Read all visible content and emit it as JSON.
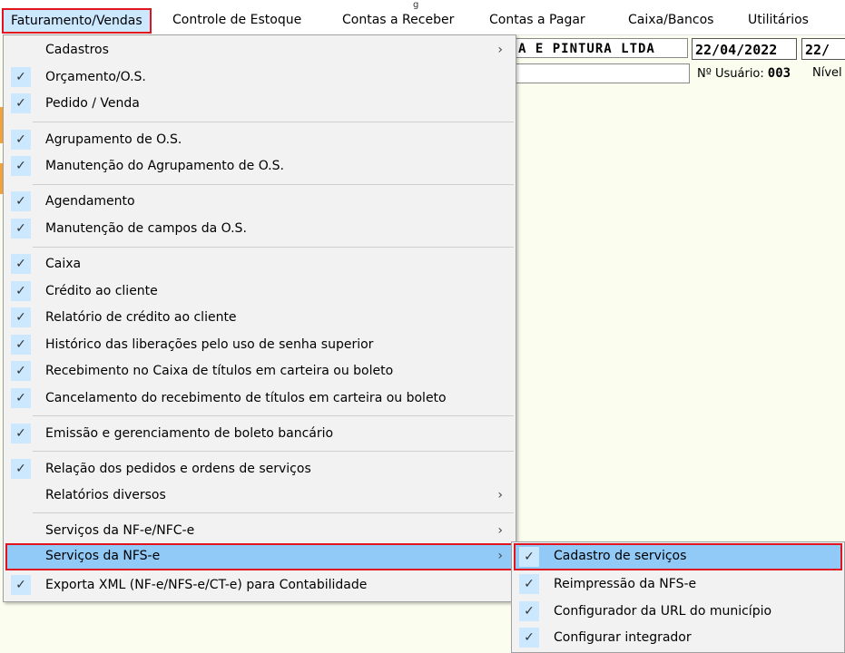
{
  "menubar": {
    "items": [
      {
        "label": "Faturamento/Vendas"
      },
      {
        "label": "Controle de Estoque"
      },
      {
        "label": "Contas a Receber"
      },
      {
        "label": "Contas a Pagar"
      },
      {
        "label": "Caixa/Bancos"
      },
      {
        "label": "Utilitários"
      }
    ]
  },
  "header": {
    "company": "A E PINTURA LTDA",
    "date1": "22/04/2022",
    "date2": "22/",
    "user_label": "Nº Usuário:",
    "user_number": "003",
    "nivel_label": "Nível"
  },
  "dropdown": {
    "items": [
      {
        "label": "Cadastros",
        "checked": false,
        "submenu": true
      },
      {
        "label": "Orçamento/O.S.",
        "checked": true
      },
      {
        "label": "Pedido / Venda",
        "checked": true
      },
      {
        "label": "Agrupamento de O.S.",
        "checked": true
      },
      {
        "label": "Manutenção do Agrupamento de O.S.",
        "checked": true
      },
      {
        "label": "Agendamento",
        "checked": true
      },
      {
        "label": "Manutenção de campos da O.S.",
        "checked": true
      },
      {
        "label": "Caixa",
        "checked": true
      },
      {
        "label": "Crédito ao cliente",
        "checked": true
      },
      {
        "label": "Relatório de crédito ao cliente",
        "checked": true
      },
      {
        "label": "Histórico das liberações pelo uso de senha superior",
        "checked": true
      },
      {
        "label": "Recebimento no Caixa de títulos em carteira ou boleto",
        "checked": true
      },
      {
        "label": "Cancelamento do recebimento de títulos em carteira ou boleto",
        "checked": true
      },
      {
        "label": "Emissão e gerenciamento de boleto bancário",
        "checked": true
      },
      {
        "label": "Relação dos pedidos e ordens de serviços",
        "checked": true
      },
      {
        "label": "Relatórios diversos",
        "checked": false,
        "submenu": true
      },
      {
        "label": "Serviços da NF-e/NFC-e",
        "checked": false,
        "submenu": true
      },
      {
        "label": "Serviços da NFS-e",
        "checked": false,
        "submenu": true,
        "highlighted": true
      },
      {
        "label": "Exporta XML (NF-e/NFS-e/CT-e) para Contabilidade",
        "checked": true
      }
    ]
  },
  "submenu": {
    "items": [
      {
        "label": "Cadastro de serviços",
        "checked": true,
        "highlighted": true
      },
      {
        "label": "Reimpressão da NFS-e",
        "checked": true
      },
      {
        "label": "Configurador da URL do município",
        "checked": true
      },
      {
        "label": "Configurar integrador",
        "checked": true
      }
    ]
  },
  "glyphs": {
    "check": "✓",
    "arrow": "›"
  },
  "colors": {
    "highlight": "#91c9f7",
    "outline": "#e0141e",
    "check_bg": "#cce8ff",
    "background": "#fbfdef"
  }
}
